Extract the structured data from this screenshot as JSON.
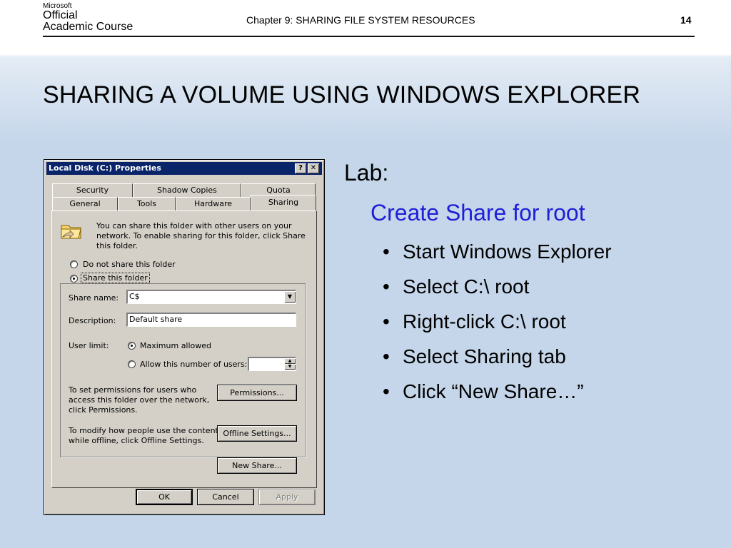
{
  "header": {
    "logo": {
      "line1": "Microsoft",
      "line2": "Official",
      "line3": "Academic Course"
    },
    "chapter": "Chapter 9: SHARING FILE SYSTEM RESOURCES",
    "page": "14"
  },
  "slide_title": "SHARING A VOLUME USING WINDOWS EXPLORER",
  "content": {
    "lab": "Lab:",
    "subheading": "Create Share for root",
    "bullets": [
      "Start Windows Explorer",
      "Select C:\\ root",
      "Right-click C:\\ root",
      "Select Sharing tab",
      "Click “New Share…”"
    ],
    "subheading_color": "#1f1fd6"
  },
  "dialog": {
    "title": "Local Disk (C:) Properties",
    "help_button": "?",
    "close_button": "✕",
    "tabs_row1": [
      "Security",
      "Shadow Copies",
      "Quota"
    ],
    "tabs_row2": [
      "General",
      "Tools",
      "Hardware",
      "Sharing"
    ],
    "active_tab": "Sharing",
    "info_text": "You can share this folder with other users on your network.  To enable sharing for this folder, click Share this folder.",
    "radio_not_share": "Do not share this folder",
    "radio_share": "Share this folder",
    "share_name_label": "Share name:",
    "share_name_value": "C$",
    "description_label": "Description:",
    "description_value": "Default share",
    "user_limit_label": "User limit:",
    "max_allowed": "Maximum allowed",
    "allow_number": "Allow this number of users:",
    "permissions_text": "To set permissions for users who access this folder over the network, click Permissions.",
    "permissions_button": "Permissions...",
    "offline_text": "To modify how people use the content while offline, click Offline Settings.",
    "offline_button": "Offline Settings...",
    "new_share_button": "New Share...",
    "ok_button": "OK",
    "cancel_button": "Cancel",
    "apply_button": "Apply"
  }
}
